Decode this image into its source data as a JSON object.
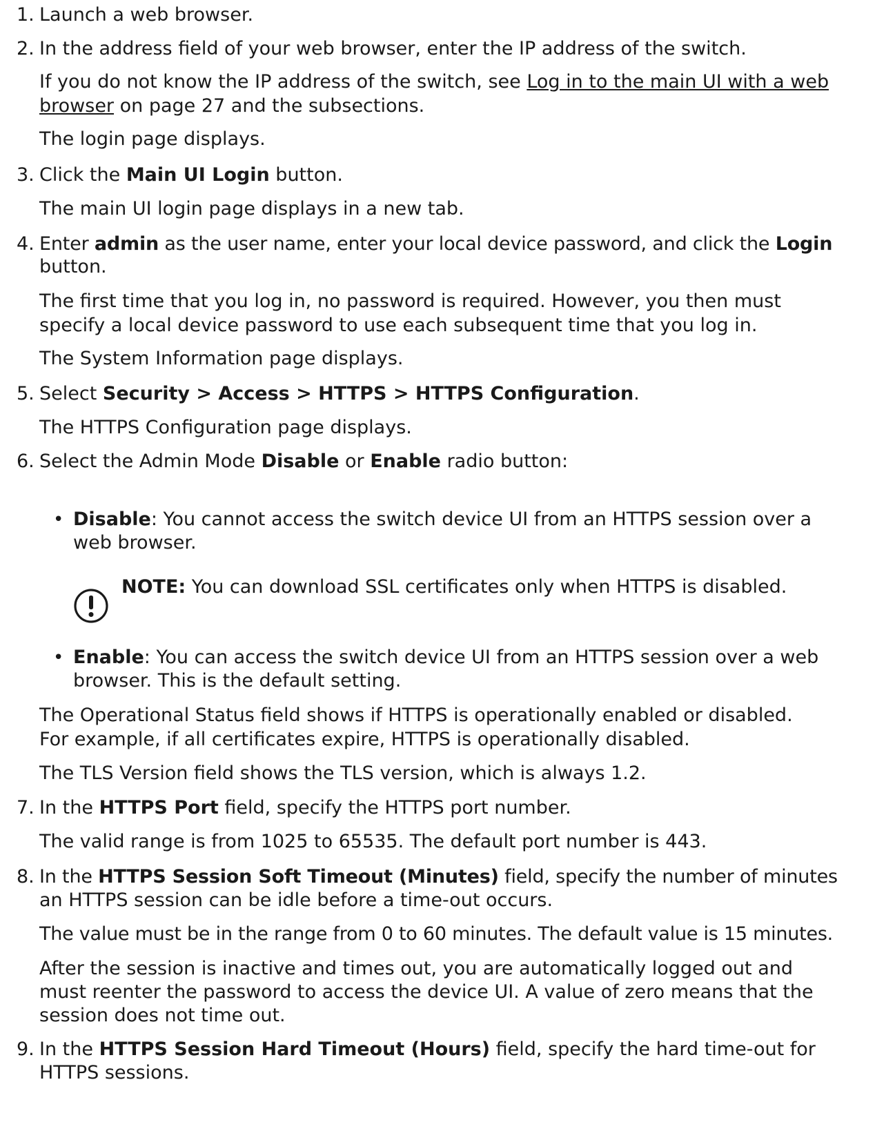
{
  "steps": [
    {
      "num": "1.",
      "text": "Launch a web browser."
    },
    {
      "num": "2.",
      "text": "In the address field of your web browser, enter the IP address of the switch.",
      "para1_pre": "If you do not know the IP address of the switch, see ",
      "link_line1": "Log in to the main UI with a web",
      "link_line2": "browser",
      "para1_post": " on page 27 and the subsections.",
      "para2": "The login page displays."
    },
    {
      "num": "3.",
      "pre": "Click the ",
      "bold": "Main UI Login",
      "post": " button.",
      "para1": "The main UI login page displays in a new tab."
    },
    {
      "num": "4.",
      "pre": "Enter ",
      "bold1": "admin",
      "mid": " as the user name, enter your local device password, and click the ",
      "bold2": "Login",
      "post": "button.",
      "para1_line1": "The first time that you log in, no password is required. However, you then must",
      "para1_line2": "specify a local device password to use each subsequent time that you log in.",
      "para2": "The System Information page displays."
    },
    {
      "num": "5.",
      "pre": "Select ",
      "bold": "Security > Access > HTTPS > HTTPS Configuration",
      "post": ".",
      "para1": "The HTTPS Configuration page displays."
    },
    {
      "num": "6.",
      "pre": "Select the Admin Mode ",
      "bold1": "Disable",
      "mid": " or ",
      "bold2": "Enable",
      "post": " radio button:",
      "bullets": [
        {
          "bold": "Disable",
          "line1": ": You cannot access the switch device UI from an HTTPS session over a",
          "line2": "web browser."
        },
        {
          "bold": "Enable",
          "line1": ": You can access the switch device UI from an HTTPS session over a web",
          "line2": "browser. This is the default setting."
        }
      ],
      "note": {
        "label": "NOTE:",
        "text": " You can download SSL certificates only when HTTPS is disabled.",
        "icon": "exclamation-circle-icon"
      },
      "para1_line1": "The Operational Status field shows if HTTPS is operationally enabled or disabled.",
      "para1_line2": "For example, if all certificates expire, HTTPS is operationally disabled.",
      "para2": "The TLS Version field shows the TLS version, which is always 1.2."
    },
    {
      "num": "7.",
      "pre": "In the ",
      "bold": "HTTPS Port",
      "post": " field, specify the HTTPS port number.",
      "para1": "The valid range is from 1025 to 65535. The default port number is 443."
    },
    {
      "num": "8.",
      "pre": "In the ",
      "bold": "HTTPS Session Soft Timeout (Minutes)",
      "post": " field, specify the number of minutes",
      "line2": "an HTTPS session can be idle before a time-out occurs.",
      "para1": "The value must be in the range from 0 to 60 minutes. The default value is 15 minutes.",
      "para2_line1": "After the session is inactive and times out, you are automatically logged out and",
      "para2_line2": "must reenter the password to access the device UI. A value of zero means that the",
      "para2_line3": "session does not time out."
    },
    {
      "num": "9.",
      "pre": "In the ",
      "bold": "HTTPS Session Hard Timeout (Hours)",
      "post": " field, specify the hard time-out for",
      "line2": "HTTPS sessions."
    }
  ]
}
